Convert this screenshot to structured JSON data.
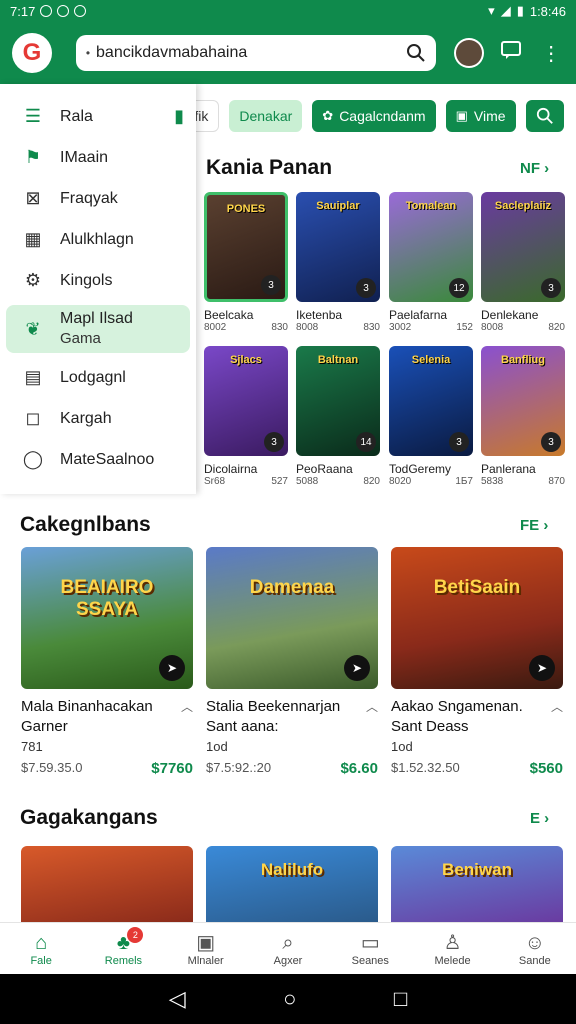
{
  "status_bar": {
    "time_left": "7:17",
    "time_right": "1:8:46"
  },
  "app_bar": {
    "logo_letter": "G",
    "search_value": "bancikdavmabahaina",
    "search_lead": "•"
  },
  "drawer": {
    "items": [
      {
        "label": "Rala",
        "icon": "list-icon"
      },
      {
        "label": "IMaain",
        "icon": "flag-icon"
      },
      {
        "label": "Fraqyak",
        "icon": "chart-box-icon"
      },
      {
        "label": "Alulkhlagn",
        "icon": "grid-icon"
      },
      {
        "label": "Kingols",
        "icon": "gear-icon"
      },
      {
        "label": "Mapl Ilsad",
        "sub": "Gama",
        "icon": "leaf-icon",
        "selected": true
      },
      {
        "label": "Lodgagnl",
        "icon": "calendar-icon"
      },
      {
        "label": "Kargah",
        "icon": "bookmark-icon"
      },
      {
        "label": "MateSaalnoo",
        "icon": "chat-icon"
      }
    ]
  },
  "filters": {
    "chip1": "adafik",
    "chip2": "Denakar",
    "chip3": "Cagalcndanm",
    "chip4": "Vime"
  },
  "section1": {
    "title": "Kania Panan",
    "more": "NF ›"
  },
  "grid": [
    {
      "art": "PONES",
      "badge": "3",
      "name": "Beelcaka",
      "meta_left": "8002",
      "meta_right": "830"
    },
    {
      "art": "Sauiplar",
      "badge": "3",
      "name": "Iketenba",
      "meta_left": "8008",
      "meta_right": "830"
    },
    {
      "art": "Tomalean",
      "badge": "12",
      "name": "Paelafarna",
      "meta_left": "3002",
      "meta_right": "152"
    },
    {
      "art": "Sacleplaiiz",
      "badge": "3",
      "name": "Denlekane",
      "meta_left": "8008",
      "meta_right": "820"
    },
    {
      "art": "Sjlacs",
      "badge": "3",
      "name": "Dicolairna",
      "meta_left": "Sr68",
      "meta_right": "527"
    },
    {
      "art": "Baltnan",
      "badge": "14",
      "name": "PeoRaana",
      "meta_left": "5088",
      "meta_right": "820"
    },
    {
      "art": "Selenia",
      "badge": "3",
      "name": "TodGeremy",
      "meta_left": "8020",
      "meta_right": "1Б7"
    },
    {
      "art": "Banfliug",
      "badge": "3",
      "name": "Panlerana",
      "meta_left": "5838",
      "meta_right": "870"
    }
  ],
  "section2": {
    "title": "Cakegnlbans",
    "more": "FE ›"
  },
  "big_cards": [
    {
      "art": "BEAIAIRO SSAYA",
      "title": "Mala Binanhacakan",
      "title2": "Garner",
      "rating": "781",
      "old_price": "$7.59.35.0",
      "price": "$7760"
    },
    {
      "art": "Damenaa",
      "title": "Stalia Beekennarjan",
      "title2": "Sant aana:",
      "rating": "1od",
      "old_price": "$7.5:92.:20",
      "price": "$6.60"
    },
    {
      "art": "BetiSaain",
      "title": "Aakao Sngamenan.",
      "title2": "Sant Deass",
      "rating": "1od",
      "old_price": "$1.52.32.50",
      "price": "$560"
    }
  ],
  "section3": {
    "title": "Gagakangans",
    "more": "E ›"
  },
  "strip_cards": [
    {
      "art": ""
    },
    {
      "art": "Nalilufo"
    },
    {
      "art": "Beniwan"
    }
  ],
  "bottom_nav": [
    {
      "label": "Fale",
      "icon": "home-icon",
      "active": true
    },
    {
      "label": "Remels",
      "icon": "people-icon",
      "badge": "2",
      "active": true
    },
    {
      "label": "Mlnaler",
      "icon": "book-icon"
    },
    {
      "label": "Agxer",
      "icon": "search-icon"
    },
    {
      "label": "Seanes",
      "icon": "window-icon"
    },
    {
      "label": "Melede",
      "icon": "person-icon"
    },
    {
      "label": "Sande",
      "icon": "profile-icon"
    }
  ],
  "colors": {
    "accent": "#0f8a4c",
    "accent_light": "#d6f2dd",
    "badge_red": "#e53935"
  }
}
